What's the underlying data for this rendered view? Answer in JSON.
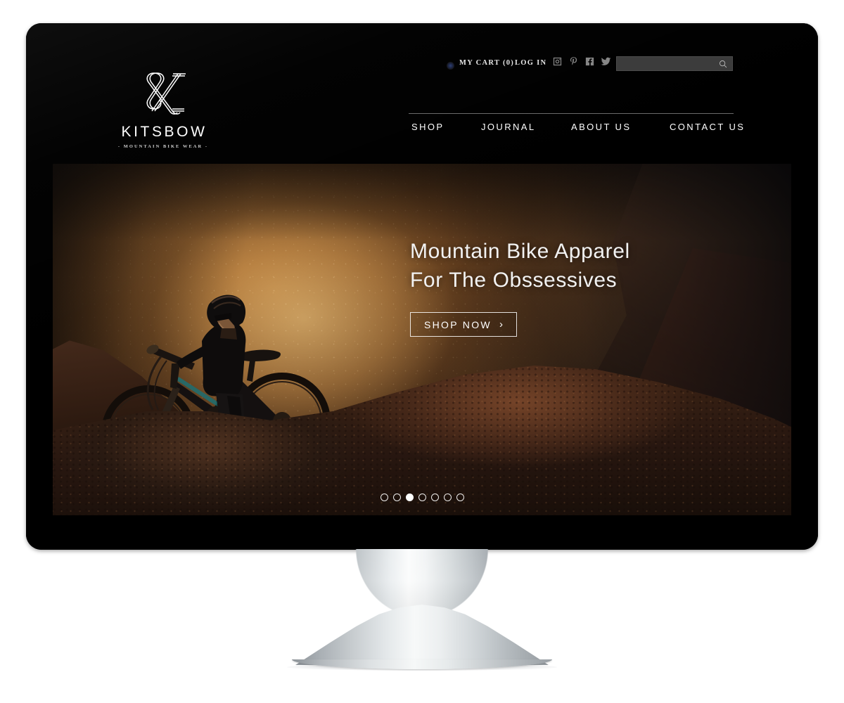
{
  "device": {
    "type": "desktop-monitor",
    "webcam": "webcam-dot"
  },
  "site": {
    "brand": {
      "wordmark": "KITSBOW",
      "tagline": "- MOUNTAIN BIKE WEAR -",
      "monogram": "K"
    },
    "utility_bar": {
      "cart_label": "MY CART (0)",
      "login_label": "LOG IN",
      "social": [
        {
          "name": "instagram-icon",
          "label": "Instagram"
        },
        {
          "name": "pinterest-icon",
          "label": "Pinterest"
        },
        {
          "name": "facebook-icon",
          "label": "Facebook"
        },
        {
          "name": "twitter-icon",
          "label": "Twitter"
        }
      ],
      "search": {
        "value": "",
        "placeholder": "",
        "icon": "search-icon"
      }
    },
    "main_nav": [
      {
        "label": "SHOP"
      },
      {
        "label": "JOURNAL"
      },
      {
        "label": "ABOUT US"
      },
      {
        "label": "CONTACT US"
      }
    ],
    "hero": {
      "headline_line1": "Mountain Bike Apparel",
      "headline_line2": "For The Obssessives",
      "cta_label": "SHOP NOW",
      "cta_chevron": "›",
      "image_alt": "Mountain biker pushing bike up a rocky slope in golden canyon dust",
      "carousel": {
        "total": 7,
        "active_index": 3
      }
    }
  },
  "colors": {
    "page_background": "#ffffff",
    "screen_background": "#000000",
    "bezel": "#0a0a0c",
    "nav_text": "#ffffff",
    "nav_rule": "#6a6a6a",
    "search_field": "#3b3b3b",
    "hero_accent_warm": "#c98a45",
    "hero_text": "#f2f2f2",
    "stand_metal": "#d8dddf"
  }
}
